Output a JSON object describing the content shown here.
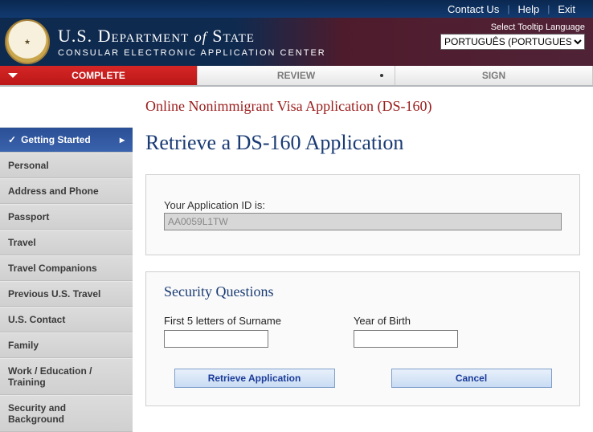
{
  "top_nav": {
    "contact": "Contact Us",
    "help": "Help",
    "exit": "Exit"
  },
  "header": {
    "dept_prefix": "U.S. D",
    "dept_rest": "epartment",
    "of": "of",
    "state_prefix": "S",
    "state_rest": "tate",
    "subtitle": "CONSULAR ELECTRONIC APPLICATION CENTER",
    "lang_label": "Select Tooltip Language",
    "lang_selected": "PORTUGUÊS (PORTUGUESE)"
  },
  "tabs": {
    "complete": "COMPLETE",
    "review": "REVIEW",
    "sign": "SIGN"
  },
  "sidebar": {
    "items": [
      "Getting Started",
      "Personal",
      "Address and Phone",
      "Passport",
      "Travel",
      "Travel Companions",
      "Previous U.S. Travel",
      "U.S. Contact",
      "Family",
      "Work / Education / Training",
      "Security and Background"
    ]
  },
  "content": {
    "app_title": "Online Nonimmigrant Visa Application (DS-160)",
    "page_heading": "Retrieve a DS-160 Application",
    "appid_label": "Your Application ID is:",
    "appid_value": "AA0059L1TW",
    "security_heading": "Security Questions",
    "q_surname": "First 5 letters of Surname",
    "q_yob": "Year of Birth",
    "btn_retrieve": "Retrieve Application",
    "btn_cancel": "Cancel"
  }
}
